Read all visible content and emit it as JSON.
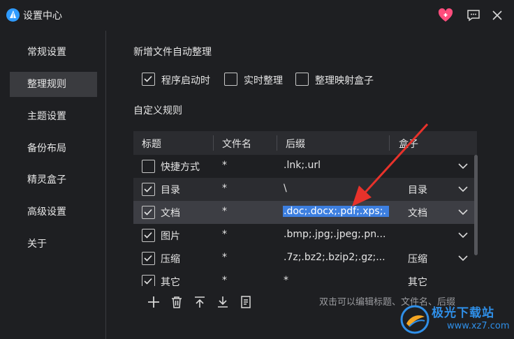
{
  "window": {
    "title": "设置中心"
  },
  "sidebar": {
    "items": [
      {
        "label": "常规设置",
        "active": false
      },
      {
        "label": "整理规则",
        "active": true
      },
      {
        "label": "主题设置",
        "active": false
      },
      {
        "label": "备份布局",
        "active": false
      },
      {
        "label": "精灵盒子",
        "active": false
      },
      {
        "label": "高级设置",
        "active": false
      },
      {
        "label": "关于",
        "active": false
      }
    ]
  },
  "auto_organize": {
    "title": "新增文件自动整理",
    "options": [
      {
        "label": "程序启动时",
        "checked": true
      },
      {
        "label": "实时整理",
        "checked": false
      },
      {
        "label": "整理映射盒子",
        "checked": false
      }
    ]
  },
  "custom_rules": {
    "title": "自定义规则",
    "columns": [
      "标题",
      "文件名",
      "后缀",
      "盒子"
    ],
    "rows": [
      {
        "checked": false,
        "title": "快捷方式",
        "filename": "*",
        "suffix": ".lnk;.url",
        "box": ""
      },
      {
        "checked": true,
        "title": "目录",
        "filename": "*",
        "suffix": "\\",
        "box": "目录"
      },
      {
        "checked": true,
        "title": "文档",
        "filename": "*",
        "suffix": ".doc;.docx;.pdf;.xps;.",
        "box": "文档",
        "selected": true
      },
      {
        "checked": true,
        "title": "图片",
        "filename": "*",
        "suffix": ".bmp;.jpg;.jpeg;.pn...",
        "box": ""
      },
      {
        "checked": true,
        "title": "压缩",
        "filename": "*",
        "suffix": ".7z;.bz2;.bzip2;.gz;...",
        "box": "压缩"
      },
      {
        "checked": true,
        "title": "其它",
        "filename": "*",
        "suffix": "*",
        "box": "其它"
      }
    ]
  },
  "footer": {
    "hint": "双击可以编辑标题、文件名、后缀"
  },
  "watermark": {
    "name": "极光下载站",
    "url": "www.xz7.com"
  },
  "colors": {
    "background": "#1e1f22",
    "row_alt": "#2b2c30",
    "selection": "#3d7fe0",
    "heart": "#ff4d7d",
    "arrow": "#e8322b"
  }
}
